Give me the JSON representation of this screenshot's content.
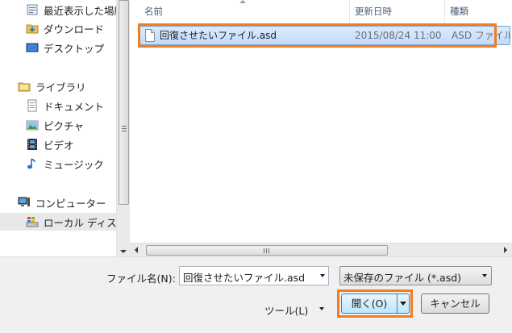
{
  "sidebar": {
    "items": [
      {
        "label": "最近表示した場所",
        "icon": "recent-places-icon"
      },
      {
        "label": "ダウンロード",
        "icon": "downloads-folder-icon"
      },
      {
        "label": "デスクトップ",
        "icon": "desktop-icon"
      },
      {
        "label": "ライブラリ",
        "icon": "library-icon"
      },
      {
        "label": "ドキュメント",
        "icon": "documents-icon"
      },
      {
        "label": "ピクチャ",
        "icon": "pictures-icon"
      },
      {
        "label": "ビデオ",
        "icon": "videos-icon"
      },
      {
        "label": "ミュージック",
        "icon": "music-icon"
      },
      {
        "label": "コンピューター",
        "icon": "computer-icon"
      },
      {
        "label": "ローカル ディスク",
        "icon": "local-disk-icon"
      }
    ]
  },
  "filelist": {
    "columns": {
      "name": "名前",
      "date": "更新日時",
      "type": "種類"
    },
    "rows": [
      {
        "name": "回復させたいファイル.asd",
        "date": "2015/08/24 11:00",
        "type": "ASD ファイル"
      }
    ]
  },
  "bottom": {
    "filename_label": "ファイル名(N):",
    "filename_value": "回復させたいファイル.asd",
    "filetype_value": "未保存のファイル (*.asd)",
    "tools_label": "ツール(L)",
    "open_label": "開く(O)",
    "cancel_label": "キャンセル"
  },
  "colors": {
    "highlight": "#f07d22",
    "selection": "#c1dbfc",
    "header_text": "#4c607a"
  }
}
